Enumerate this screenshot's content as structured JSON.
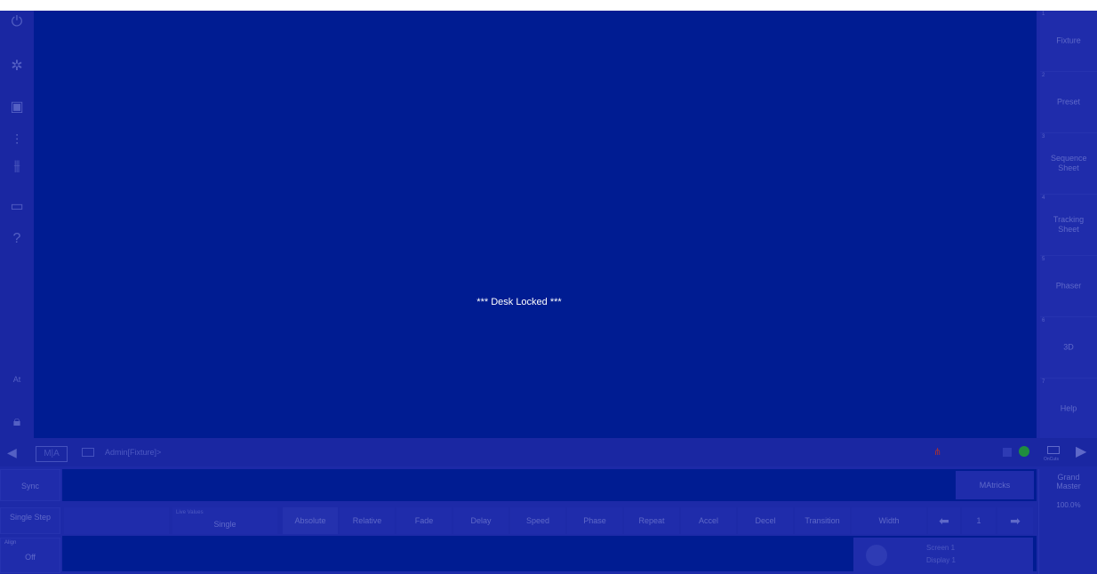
{
  "lock_message": "*** Desk Locked ***",
  "sidebar": {
    "icons": [
      "power-icon",
      "settings-icon",
      "layout-icon",
      "faders-icon",
      "faders-alt-icon",
      "monitor-icon",
      "help-icon"
    ],
    "at_label": "At",
    "lock_icon": "lock-icon"
  },
  "right_panel": [
    {
      "num": "1",
      "label": "Fixture"
    },
    {
      "num": "2",
      "label": "Preset"
    },
    {
      "num": "3",
      "label": "Sequence Sheet"
    },
    {
      "num": "4",
      "label": "Tracking Sheet"
    },
    {
      "num": "5",
      "label": "Phaser"
    },
    {
      "num": "6",
      "label": "3D"
    },
    {
      "num": "7",
      "label": "Help"
    }
  ],
  "command_line": {
    "ma_label": "M|A",
    "prompt": "Admin[Fixture]>",
    "keyboard_small": "OnCuts"
  },
  "bottom": {
    "sync": "Sync",
    "single_step": "Single Step",
    "off_top": "Align",
    "off": "Off",
    "live_values_label": "Live Values",
    "live_values_value": "Single",
    "tabs": [
      "Absolute",
      "Relative",
      "Fade",
      "Delay",
      "Speed",
      "Phase",
      "Repeat",
      "Accel",
      "Decel",
      "Transition",
      "Width"
    ],
    "page_value": "1",
    "matricks": "MAtricks",
    "grand_master_label": "Grand Master",
    "grand_master_value": "100.0%",
    "screen_label": "Screen 1",
    "display_label": "Display 1"
  },
  "colors": {
    "background": "#1d2aa8",
    "main": "#001c92",
    "text_dim": "#5f69c9",
    "status_green": "#1f8d3f",
    "status_red": "#a0303a"
  }
}
